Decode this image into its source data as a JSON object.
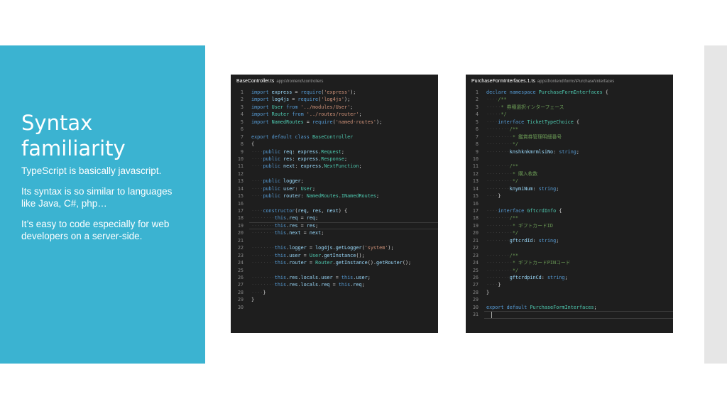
{
  "slide": {
    "title": "Syntax familiarity",
    "bullets": [
      "TypeScript is basically javascript.",
      "Its syntax is so similar to languages like Java, C#, php…",
      "It’s easy to code especially for web developers on a server-side."
    ]
  },
  "editors": [
    {
      "filename": "BaseController.ts",
      "path": "apps\\frontend\\controllers",
      "active_line": 19,
      "lines": [
        "import express = require('express');",
        "import log4js = require('log4js');",
        "import User from '../modules/User';",
        "import Router from '../routes/router';",
        "import NamedRoutes = require('named-routes');",
        "",
        "export default class BaseController",
        "{",
        "····public req: express.Request;",
        "····public res: express.Response;",
        "····public next: express.NextFunction;",
        "",
        "····public logger;",
        "····public user: User;",
        "····public router: NamedRoutes.INamedRoutes;",
        "",
        "····constructor(req, res, next) {",
        "········this.req = req;",
        "········this.res = res;",
        "········this.next = next;",
        "",
        "········this.logger = log4js.getLogger('system');",
        "········this.user = User.getInstance();",
        "········this.router = Router.getInstance().getRouter();",
        "",
        "········this.res.locals.user = this.user;",
        "········this.res.locals.req = this.req;",
        "····}",
        "}",
        ""
      ]
    },
    {
      "filename": "PurchaseFormInterfaces.1.ts",
      "path": "apps\\frontend\\forms\\Purchase\\Interfaces",
      "active_line": 31,
      "lines": [
        "declare namespace PurchaseFormInterfaces {",
        "····/**",
        "·····* 券種選択インターフェース",
        "·····*/",
        "····interface TicketTypeChoice {",
        "········/**",
        "·········* 鑑賞券管理明細番号",
        "·········*/",
        "········knshknkmrmlsiNo: string;",
        "",
        "········/**",
        "·········* 購入枚数",
        "·········*/",
        "········knymiNum: string;",
        "····}",
        "",
        "····interface GftcrdInfo {",
        "········/**",
        "·········* ギフトカードID",
        "·········*/",
        "········gftcrdId: string;",
        "",
        "········/**",
        "·········* ギフトカードPINコード",
        "·········*/",
        "········gftcrdpinCd: string;",
        "····}",
        "}",
        "",
        "export default PurchaseFormInterfaces;",
        ""
      ]
    }
  ]
}
